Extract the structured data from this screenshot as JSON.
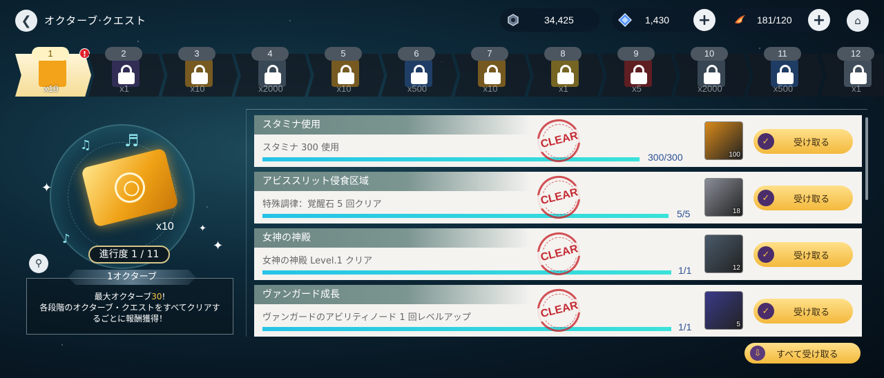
{
  "header": {
    "title": "オクターブ·クエスト",
    "back_icon": "back-arrow-icon",
    "home_icon": "home-icon"
  },
  "currencies": [
    {
      "name": "coin",
      "icon": "hex-coin-icon",
      "value": "34,425"
    },
    {
      "name": "gem",
      "icon": "blue-gem-icon",
      "value": "1,430"
    },
    {
      "name": "stamina",
      "icon": "stamina-flame-icon",
      "value": "181/120"
    }
  ],
  "stages": [
    {
      "number": "1",
      "qty": "x10",
      "locked": false,
      "color": "#f2a31a"
    },
    {
      "number": "2",
      "qty": "x1",
      "locked": true,
      "color": "#4a3a7a"
    },
    {
      "number": "3",
      "qty": "x10",
      "locked": true,
      "color": "#c88a1c"
    },
    {
      "number": "4",
      "qty": "x2000",
      "locked": true,
      "color": "#5a6a7a"
    },
    {
      "number": "5",
      "qty": "x10",
      "locked": true,
      "color": "#c88a1c"
    },
    {
      "number": "6",
      "qty": "x500",
      "locked": true,
      "color": "#2a5a9a"
    },
    {
      "number": "7",
      "qty": "x10",
      "locked": true,
      "color": "#c88a1c"
    },
    {
      "number": "8",
      "qty": "x1",
      "locked": true,
      "color": "#c8a020"
    },
    {
      "number": "9",
      "qty": "x5",
      "locked": true,
      "color": "#a02020"
    },
    {
      "number": "10",
      "qty": "x2000",
      "locked": true,
      "color": "#5a6a7a"
    },
    {
      "number": "11",
      "qty": "x500",
      "locked": true,
      "color": "#2a5a9a"
    },
    {
      "number": "12",
      "qty": "x1",
      "locked": true,
      "color": "#6a7a8a"
    }
  ],
  "left_panel": {
    "ticket_qty": "x10",
    "progress": "進行度 1 / 11",
    "octave": "1オクターブ",
    "info_line1_prefix": "最大オクターブ",
    "info_line1_value": "30",
    "info_line1_suffix": "!",
    "info_line2": "各段階のオクターブ・クエストをすべてクリアす",
    "info_line3": "るごとに報酬獲得！"
  },
  "missions": [
    {
      "title": "スタミナ使用",
      "description": "スタミナ 300 使用",
      "progress": "300/300",
      "progress_fraction": 1.0,
      "status": "CLEAR",
      "reward_icon": "golden-wing-icon",
      "reward_color": "#d98a1a",
      "reward_qty": "100",
      "claim_label": "受け取る"
    },
    {
      "title": "アビススリット侵食区域",
      "description": "特殊調律：覚醒石 5 回クリア",
      "progress": "5/5",
      "progress_fraction": 1.0,
      "status": "CLEAR",
      "reward_icon": "crystal-shard-icon",
      "reward_color": "#8a8e98",
      "reward_qty": "18",
      "claim_label": "受け取る"
    },
    {
      "title": "女神の神殿",
      "description": "女神の神殿 Level.1 クリア",
      "progress": "1/1",
      "progress_fraction": 1.0,
      "status": "CLEAR",
      "reward_icon": "book-icon",
      "reward_color": "#4a5a6a",
      "reward_qty": "12",
      "claim_label": "受け取る"
    },
    {
      "title": "ヴァンガード成長",
      "description": "ヴァンガードのアビリティノード 1 回レベルアップ",
      "progress": "1/1",
      "progress_fraction": 1.0,
      "status": "CLEAR",
      "reward_icon": "purple-gem-icon",
      "reward_color": "#3a3a8a",
      "reward_qty": "5",
      "claim_label": "受け取る"
    }
  ],
  "claim_all_label": "すべて受け取る"
}
